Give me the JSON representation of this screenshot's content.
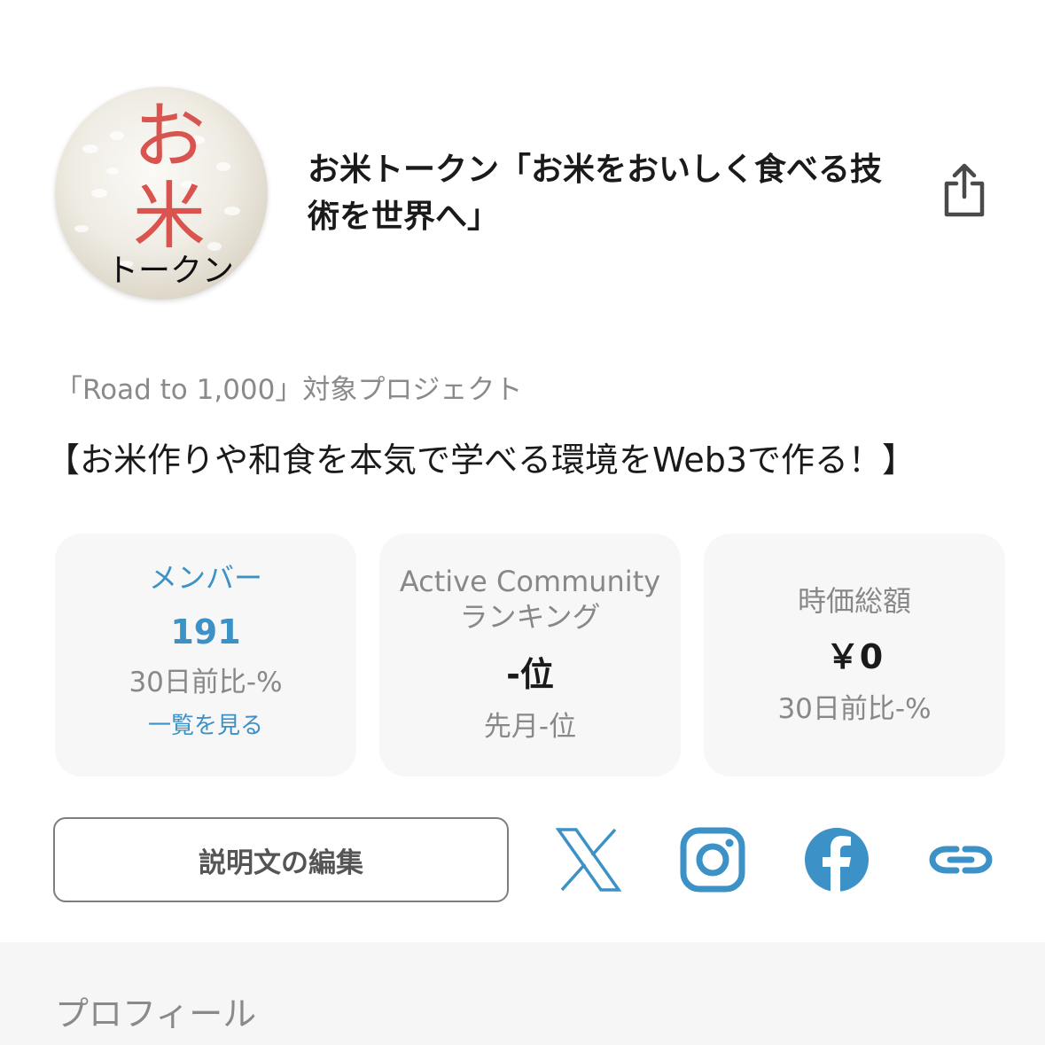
{
  "project": {
    "logo": {
      "char_top": "お",
      "char_bottom": "米",
      "subtext": "トークン"
    },
    "title": "お米トークン「お米をおいしく食べる技術を世界へ」",
    "road_label": "「Road to 1,000」対象プロジェクト",
    "description": "【お米作りや和食を本気で学べる環境をWeb3で作る！】"
  },
  "stats": {
    "members": {
      "label": "メンバー",
      "value": "191",
      "change": "30日前比-%",
      "link": "一覧を見る"
    },
    "ranking": {
      "label_line1": "Active Community",
      "label_line2": "ランキング",
      "value": "-位",
      "sub": "先月-位"
    },
    "market_cap": {
      "label": "時価総額",
      "value": "￥0",
      "change": "30日前比-%"
    }
  },
  "actions": {
    "edit_label": "説明文の編集"
  },
  "social_icons": [
    "x-icon",
    "instagram-icon",
    "facebook-icon",
    "link-icon"
  ],
  "profile": {
    "title": "プロフィール"
  },
  "colors": {
    "accent": "#3c91c6",
    "logo_red": "#d9534f",
    "muted_text": "#888888",
    "card_bg": "#f7f7f7"
  }
}
